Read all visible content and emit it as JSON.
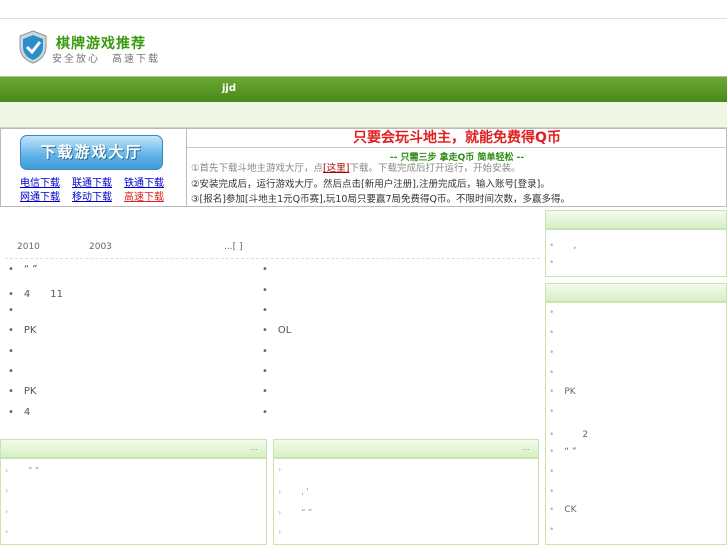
{
  "header": {
    "title": "棋牌游戏推荐",
    "subtitle": "安全放心　高速下载",
    "nav_text": "jjd"
  },
  "banner": {
    "download_button": "下载游戏大厅",
    "links": [
      "电信下载",
      "联通下载",
      "铁通下载",
      "网通下载",
      "移动下载",
      "高速下载"
    ],
    "headline": "只要会玩斗地主，就能免费得Q币",
    "subline": "-- 只需三步 拿走Q币 简单轻松 --",
    "step1_a": "①首先下载斗地主游戏大厅，点",
    "step1_link": "[这里]",
    "step1_b": "下载。下载完成后打开运行，开始安装。",
    "step2": "②安装完成后，运行游戏大厅。然后点击[新用户注册],注册完成后，输入账号[登录]。",
    "step3": "③[报名]参加[斗地主1元Q币赛],玩10局只要赢7局免费得Q币。不限时间次数，多赢多得。"
  },
  "article": {
    "year1": "2010",
    "year2": "2003",
    "more": "...[ ]"
  },
  "list_left": [
    "“ ”",
    "4　　11",
    "",
    "PK",
    "",
    "",
    "PK",
    "4"
  ],
  "list_right": [
    "",
    "",
    "",
    "OL",
    "",
    "",
    "",
    ""
  ],
  "right_box1": {
    "items": [
      "　,",
      ""
    ]
  },
  "right_box2": {
    "items": [
      "",
      "",
      "",
      "",
      "PK",
      "",
      "　　2",
      "“ ”",
      "",
      "",
      "CK",
      ""
    ]
  },
  "bottom_box1": {
    "more": "...",
    "items": [
      "　“ ”",
      "",
      "",
      ""
    ]
  },
  "bottom_box2": {
    "more": "...",
    "items": [
      "",
      "　, '",
      "　“ ”",
      ""
    ]
  }
}
